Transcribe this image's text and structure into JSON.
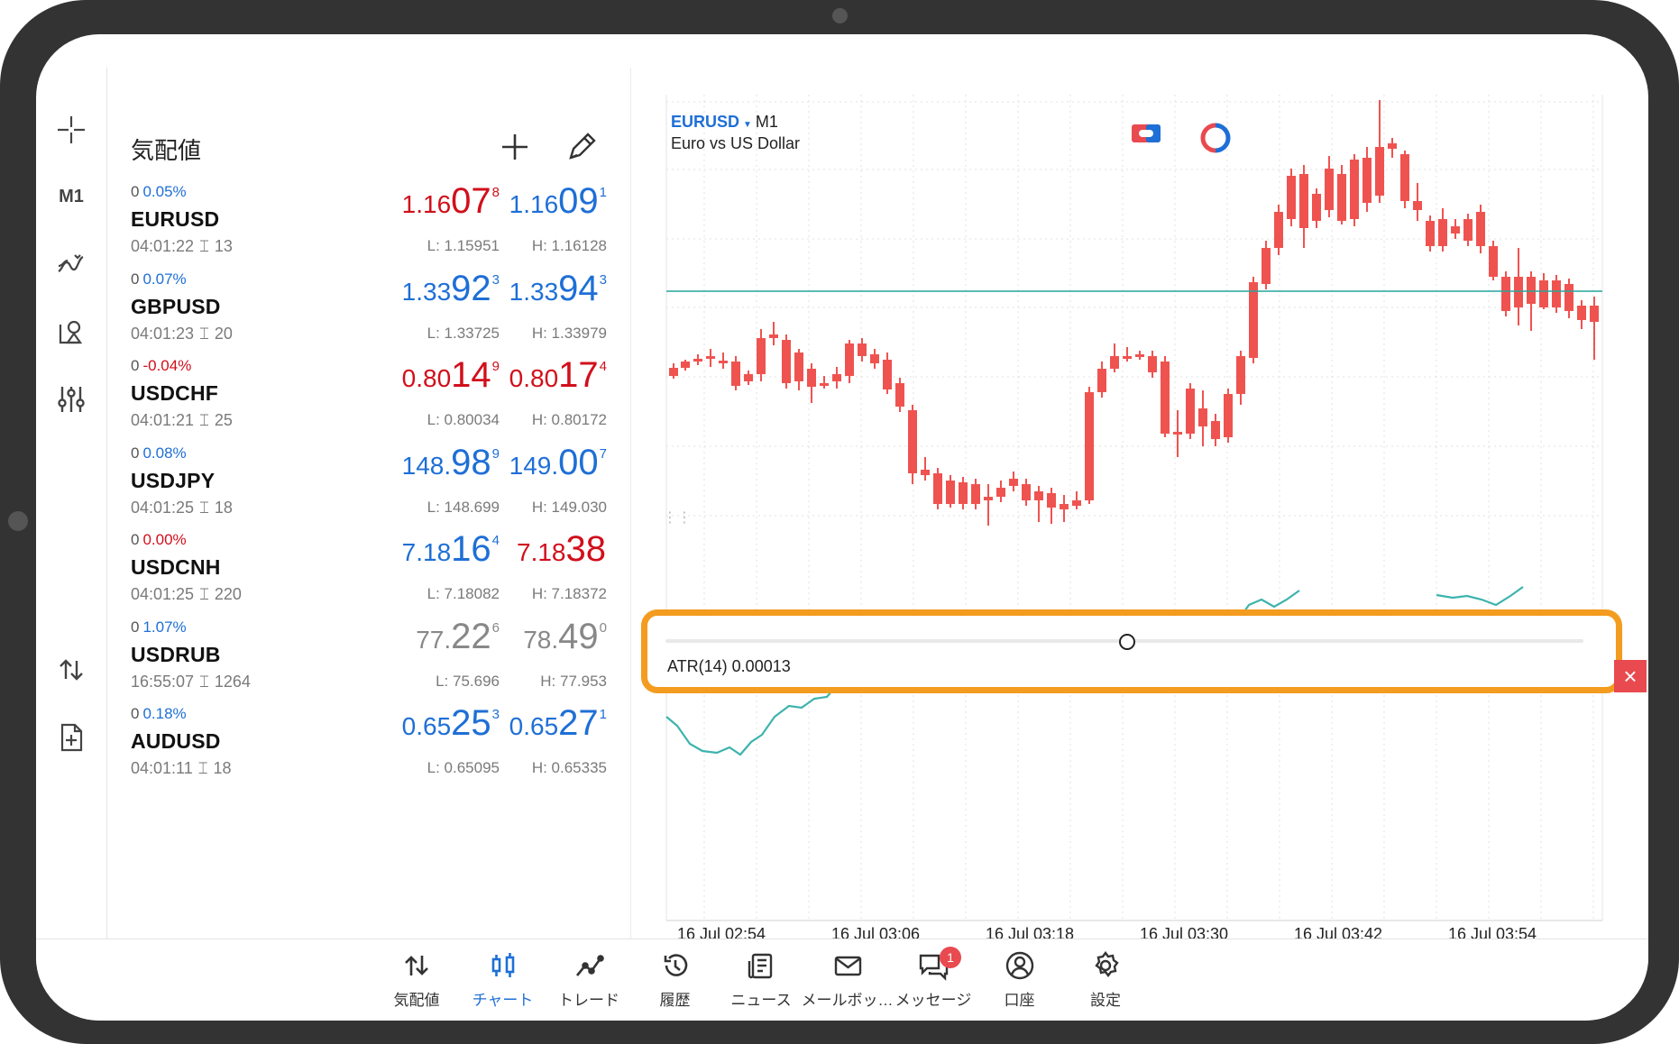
{
  "rail": {
    "timeframe": "M1"
  },
  "quotes": {
    "title": "気配値",
    "rows": [
      {
        "symbol": "EURUSD",
        "change": "0",
        "pct": "0.05%",
        "pct_color": "blue",
        "time": "04:01:22",
        "spread": "13",
        "bid": {
          "small": "1.16",
          "big": "07",
          "sup": "8",
          "color": "red"
        },
        "ask": {
          "small": "1.16",
          "big": "09",
          "sup": "1",
          "color": "blue"
        },
        "low": "L: 1.15951",
        "high": "H: 1.16128"
      },
      {
        "symbol": "GBPUSD",
        "change": "0",
        "pct": "0.07%",
        "pct_color": "blue",
        "time": "04:01:23",
        "spread": "20",
        "bid": {
          "small": "1.33",
          "big": "92",
          "sup": "3",
          "color": "blue"
        },
        "ask": {
          "small": "1.33",
          "big": "94",
          "sup": "3",
          "color": "blue"
        },
        "low": "L: 1.33725",
        "high": "H: 1.33979"
      },
      {
        "symbol": "USDCHF",
        "change": "0",
        "pct": "-0.04%",
        "pct_color": "red",
        "time": "04:01:21",
        "spread": "25",
        "bid": {
          "small": "0.80",
          "big": "14",
          "sup": "9",
          "color": "red"
        },
        "ask": {
          "small": "0.80",
          "big": "17",
          "sup": "4",
          "color": "red"
        },
        "low": "L: 0.80034",
        "high": "H: 0.80172"
      },
      {
        "symbol": "USDJPY",
        "change": "0",
        "pct": "0.08%",
        "pct_color": "blue",
        "time": "04:01:25",
        "spread": "18",
        "bid": {
          "small": "148.",
          "big": "98",
          "sup": "9",
          "color": "blue"
        },
        "ask": {
          "small": "149.",
          "big": "00",
          "sup": "7",
          "color": "blue"
        },
        "low": "L: 148.699",
        "high": "H: 149.030"
      },
      {
        "symbol": "USDCNH",
        "change": "0",
        "pct": "0.00%",
        "pct_color": "red",
        "time": "04:01:25",
        "spread": "220",
        "bid": {
          "small": "7.18",
          "big": "16",
          "sup": "4",
          "color": "blue"
        },
        "ask": {
          "small": "7.18",
          "big": "38",
          "sup": "",
          "color": "red"
        },
        "low": "L: 7.18082",
        "high": "H: 7.18372"
      },
      {
        "symbol": "USDRUB",
        "change": "0",
        "pct": "1.07%",
        "pct_color": "blue",
        "time": "16:55:07",
        "spread": "1264",
        "bid": {
          "small": "77.",
          "big": "22",
          "sup": "6",
          "color": "gray"
        },
        "ask": {
          "small": "78.",
          "big": "49",
          "sup": "0",
          "color": "gray"
        },
        "low": "L: 75.696",
        "high": "H: 77.953"
      },
      {
        "symbol": "AUDUSD",
        "change": "0",
        "pct": "0.18%",
        "pct_color": "blue",
        "time": "04:01:11",
        "spread": "18",
        "bid": {
          "small": "0.65",
          "big": "25",
          "sup": "3",
          "color": "blue"
        },
        "ask": {
          "small": "0.65",
          "big": "27",
          "sup": "1",
          "color": "blue"
        },
        "low": "L: 0.65095",
        "high": "H: 0.65335"
      }
    ]
  },
  "chart": {
    "symbol": "EURUSD",
    "timeframe": "M1",
    "description": "Euro vs US Dollar",
    "indicator_label": "ATR(14) 0.00013",
    "x_labels": [
      "16 Jul 02:54",
      "16 Jul 03:06",
      "16 Jul 03:18",
      "16 Jul 03:30",
      "16 Jul 03:42",
      "16 Jul 03:54"
    ],
    "bull_color": "#26a69a",
    "bear_color": "#ef5350",
    "highlight_color": "#f39c1f"
  },
  "bottom_nav": [
    {
      "label": "気配値",
      "icon": "quotes-icon",
      "active": false
    },
    {
      "label": "チャート",
      "icon": "chart-icon",
      "active": true
    },
    {
      "label": "トレード",
      "icon": "trade-icon",
      "active": false
    },
    {
      "label": "履歴",
      "icon": "history-icon",
      "active": false
    },
    {
      "label": "ニュース",
      "icon": "news-icon",
      "active": false
    },
    {
      "label": "メールボッ…",
      "icon": "mail-icon",
      "active": false
    },
    {
      "label": "メッセージ",
      "icon": "messages-icon",
      "active": false,
      "badge": "1"
    },
    {
      "label": "口座",
      "icon": "account-icon",
      "active": false
    },
    {
      "label": "設定",
      "icon": "settings-icon",
      "active": false
    }
  ]
}
